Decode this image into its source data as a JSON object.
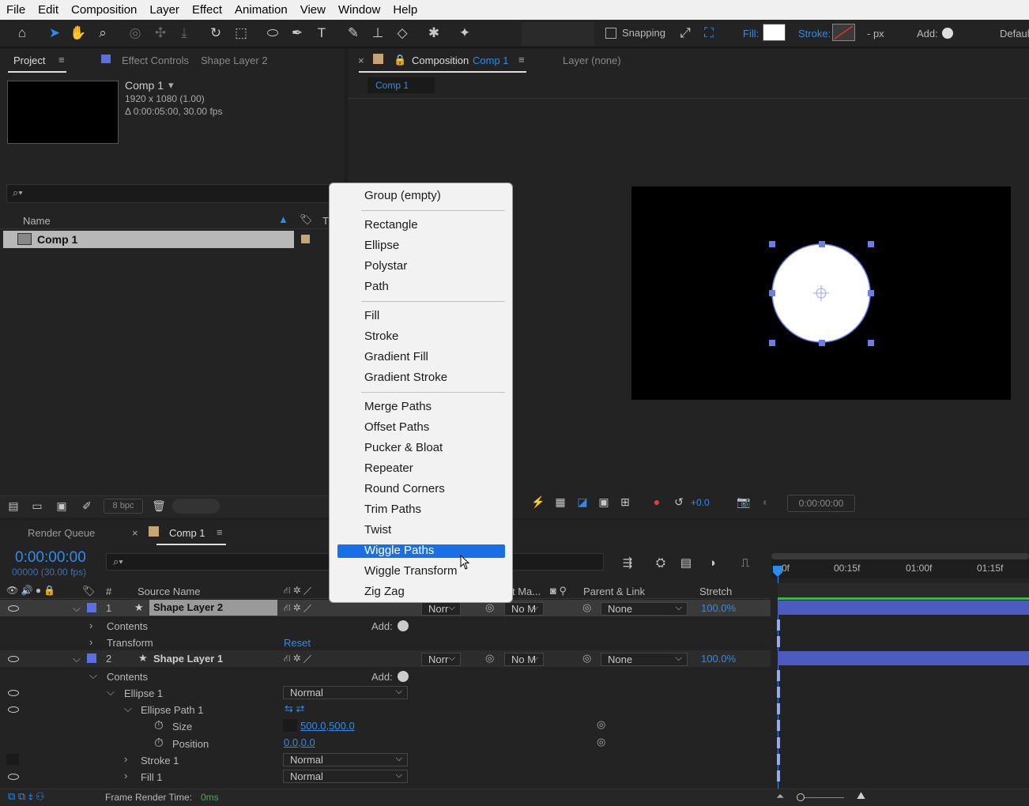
{
  "menubar": {
    "items": [
      "File",
      "Edit",
      "Composition",
      "Layer",
      "Effect",
      "Animation",
      "View",
      "Window",
      "Help"
    ]
  },
  "toolbar": {
    "snapping": "Snapping",
    "fill": "Fill:",
    "stroke": "Stroke:",
    "px": "- px",
    "add": "Add:",
    "workspace": "Defaul"
  },
  "project": {
    "tab": "Project",
    "effect_controls": "Effect Controls",
    "effect_layer": "Shape Layer 2",
    "comp_name": "Comp 1",
    "comp_size": "1920 x 1080 (1.00)",
    "comp_duration": "Δ 0:00:05:00, 30.00 fps",
    "col_name": "Name",
    "col_t": "T",
    "item": "Comp 1",
    "bpc": "8 bpc"
  },
  "comp_panel": {
    "tab_prefix": "Composition",
    "tab_comp": "Comp 1",
    "layer_tab": "Layer (none)",
    "crumb": "Comp 1",
    "exposure": "+0.0",
    "timecode": "0:00:00:00"
  },
  "context_menu": {
    "items": [
      "Group (empty)",
      "Rectangle",
      "Ellipse",
      "Polystar",
      "Path",
      "Fill",
      "Stroke",
      "Gradient Fill",
      "Gradient Stroke",
      "Merge Paths",
      "Offset Paths",
      "Pucker & Bloat",
      "Repeater",
      "Round Corners",
      "Trim Paths",
      "Twist",
      "Wiggle Paths",
      "Wiggle Transform",
      "Zig Zag"
    ],
    "selected": "Wiggle Paths"
  },
  "timeline": {
    "render_queue": "Render Queue",
    "comp_tab": "Comp 1",
    "timecode": "0:00:00:00",
    "frames": "00000 (30.00 fps)",
    "col_num": "#",
    "col_source": "Source Name",
    "col_mat": "t Ma...",
    "col_parent": "Parent & Link",
    "col_stretch": "Stretch",
    "ruler": [
      "0f",
      "00:15f",
      "01:00f",
      "01:15f"
    ],
    "layers": [
      {
        "num": "1",
        "name": "Shape Layer 2",
        "mode": "Norr",
        "mat": "No M",
        "parent": "None",
        "stretch": "100.0%"
      },
      {
        "num": "2",
        "name": "Shape Layer 1",
        "mode": "Norr",
        "mat": "No M",
        "parent": "None",
        "stretch": "100.0%"
      }
    ],
    "contents": "Contents",
    "add": "Add:",
    "transform": "Transform",
    "reset": "Reset",
    "ellipse1": "Ellipse 1",
    "normal": "Normal",
    "ellipse_path": "Ellipse Path 1",
    "size": "Size",
    "size_val": "500.0,500.0",
    "position": "Position",
    "position_val": "0.0,0.0",
    "stroke1": "Stroke 1",
    "fill1": "Fill 1",
    "frame_render": "Frame Render Time:",
    "frame_render_val": "0ms"
  },
  "colors": {
    "accent": "#2d8ceb",
    "label_blue": "#5b6fe0",
    "menu_highlight": "#1a6fe6"
  }
}
